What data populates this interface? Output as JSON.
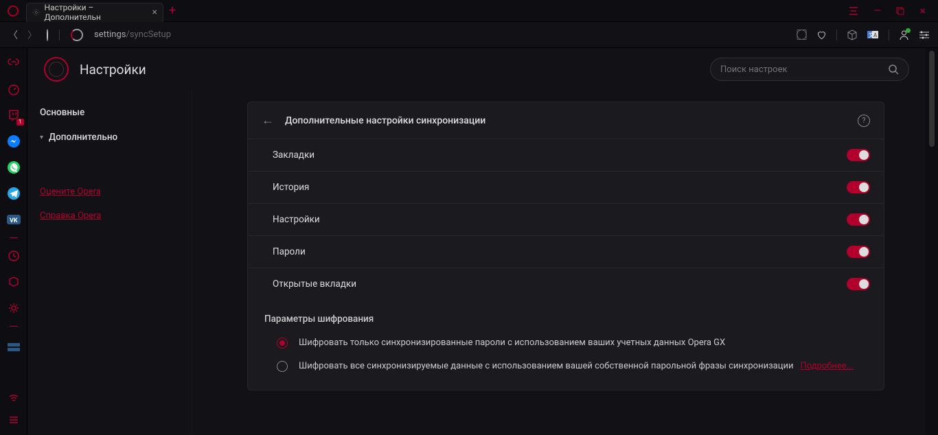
{
  "tab_title": "Настройки – Дополнительн",
  "url_host": "settings",
  "url_path": "/syncSetup",
  "page_title": "Настройки",
  "search_placeholder": "Поиск настроек",
  "sidebar": {
    "basic": "Основные",
    "advanced": "Дополнительно",
    "rate": "Оцените Opera",
    "help": "Справка Opera"
  },
  "card": {
    "title": "Дополнительные настройки синхронизации",
    "toggles": [
      "Закладки",
      "История",
      "Настройки",
      "Пароли",
      "Открытые вкладки"
    ]
  },
  "encryption": {
    "title": "Параметры шифрования",
    "opt1": "Шифровать только синхронизированные пароли с использованием ваших учетных данных Opera GX",
    "opt2": "Шифровать все синхронизируемые данные с использованием вашей собственной парольной фразы синхронизации",
    "learn_more": "Подробнее..."
  },
  "rail_badge": "1"
}
